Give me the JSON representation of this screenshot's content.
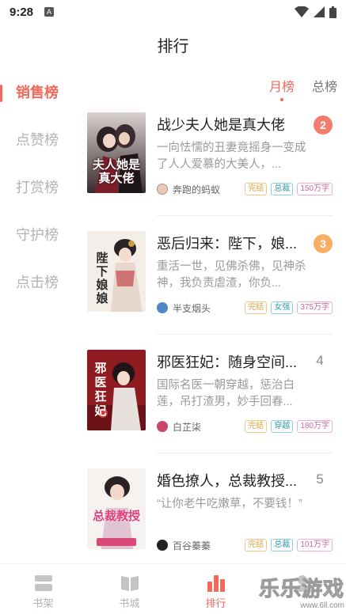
{
  "status_bar": {
    "time": "9:28",
    "notif_letter": "A"
  },
  "header": {
    "title": "排行"
  },
  "sidebar": {
    "items": [
      {
        "label": "销售榜",
        "active": true
      },
      {
        "label": "点赞榜",
        "active": false
      },
      {
        "label": "打赏榜",
        "active": false
      },
      {
        "label": "守护榜",
        "active": false
      },
      {
        "label": "点击榜",
        "active": false
      }
    ]
  },
  "tabs": [
    {
      "label": "月榜",
      "active": true
    },
    {
      "label": "总榜",
      "active": false
    }
  ],
  "books": [
    {
      "title": "战少夫人她是真大佬",
      "desc": "一向怯懦的丑妻竟摇身一变成了人人爱慕的大美人，...",
      "author": "奔跑的蚂蚁",
      "status": "完结",
      "genre": "总裁",
      "words": "150万字",
      "rank": "2",
      "rank_color": "#f27d6d",
      "cover_text": "夫人她是真大佬"
    },
    {
      "title": "恶后归来：陛下，娘...",
      "desc": "重活一世，见佛杀佛，见神杀神，我负责虐渣，你负...",
      "author": "半支烟头",
      "status": "完结",
      "genre": "女强",
      "words": "375万字",
      "rank": "3",
      "rank_color": "#f7b063",
      "cover_text": "陛下娘娘"
    },
    {
      "title": "邪医狂妃：随身空间...",
      "desc": "国际名医一朝穿越，惩治白莲，吊打渣男，妙手回春...",
      "author": "白芷柒",
      "status": "完结",
      "genre": "穿越",
      "words": "180万字",
      "rank": "4",
      "cover_text": "邪医狂妃"
    },
    {
      "title": "婚色撩人，总裁教授...",
      "desc": "“让你老牛吃嫩草，不要钱！”",
      "author": "百谷蓁蓁",
      "status": "完结",
      "genre": "总裁",
      "words": "101万字",
      "rank": "5",
      "cover_text": "总裁教授"
    }
  ],
  "bottom_nav": [
    {
      "label": "书架",
      "icon": "bookshelf-icon",
      "active": false
    },
    {
      "label": "书城",
      "icon": "book-open-icon",
      "active": false
    },
    {
      "label": "排行",
      "icon": "ranking-icon",
      "active": true
    },
    {
      "label": "",
      "icon": "profile-icon",
      "active": false
    }
  ],
  "colors": {
    "accent": "#f06a5c",
    "inactive": "#b3b3b3"
  },
  "watermark": {
    "text": "乐乐游戏",
    "url": "www.6ll.com"
  }
}
